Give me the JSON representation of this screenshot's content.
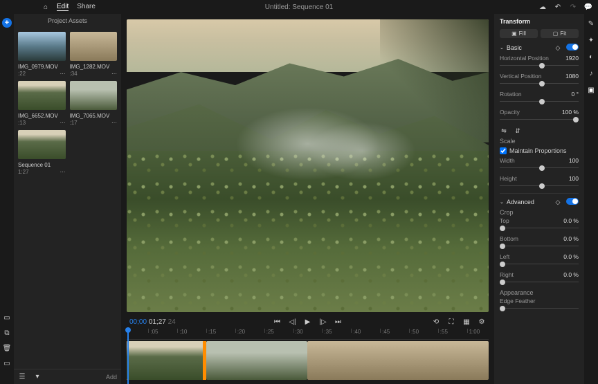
{
  "app": {
    "title": "Untitled: Sequence 01"
  },
  "menu": {
    "edit": "Edit",
    "share": "Share"
  },
  "assets_panel": {
    "title": "Project Assets",
    "add_label": "Add"
  },
  "assets": [
    {
      "name": "IMG_0979.MOV",
      "duration": ":22"
    },
    {
      "name": "IMG_1282.MOV",
      "duration": ":34"
    },
    {
      "name": "IMG_6652.MOV",
      "duration": ":13"
    },
    {
      "name": "IMG_7065.MOV",
      "duration": ":17"
    },
    {
      "name": "Sequence 01",
      "duration": "1:27"
    }
  ],
  "playback": {
    "current": "00;00",
    "duration": "01;27",
    "frames": "24"
  },
  "timeline": {
    "ticks": [
      ":05",
      ":10",
      ":15",
      ":20",
      ":25",
      ":30",
      ":35",
      ":40",
      ":45",
      ":50",
      ":55",
      "1:00"
    ]
  },
  "transform": {
    "title": "Transform",
    "fill": "Fill",
    "fit": "Fit",
    "basic": "Basic",
    "h_pos": {
      "label": "Horizontal Position",
      "value": "1920"
    },
    "v_pos": {
      "label": "Vertical Position",
      "value": "1080"
    },
    "rotation": {
      "label": "Rotation",
      "value": "0 °"
    },
    "opacity": {
      "label": "Opacity",
      "value": "100 %"
    },
    "scale": "Scale",
    "maintain": "Maintain Proportions",
    "width": {
      "label": "Width",
      "value": "100"
    },
    "height": {
      "label": "Height",
      "value": "100"
    },
    "advanced": "Advanced",
    "crop": "Crop",
    "top": {
      "label": "Top",
      "value": "0.0 %"
    },
    "bottom": {
      "label": "Bottom",
      "value": "0.0 %"
    },
    "left": {
      "label": "Left",
      "value": "0.0 %"
    },
    "right": {
      "label": "Right",
      "value": "0.0 %"
    },
    "appearance": "Appearance",
    "feather": "Edge Feather"
  }
}
